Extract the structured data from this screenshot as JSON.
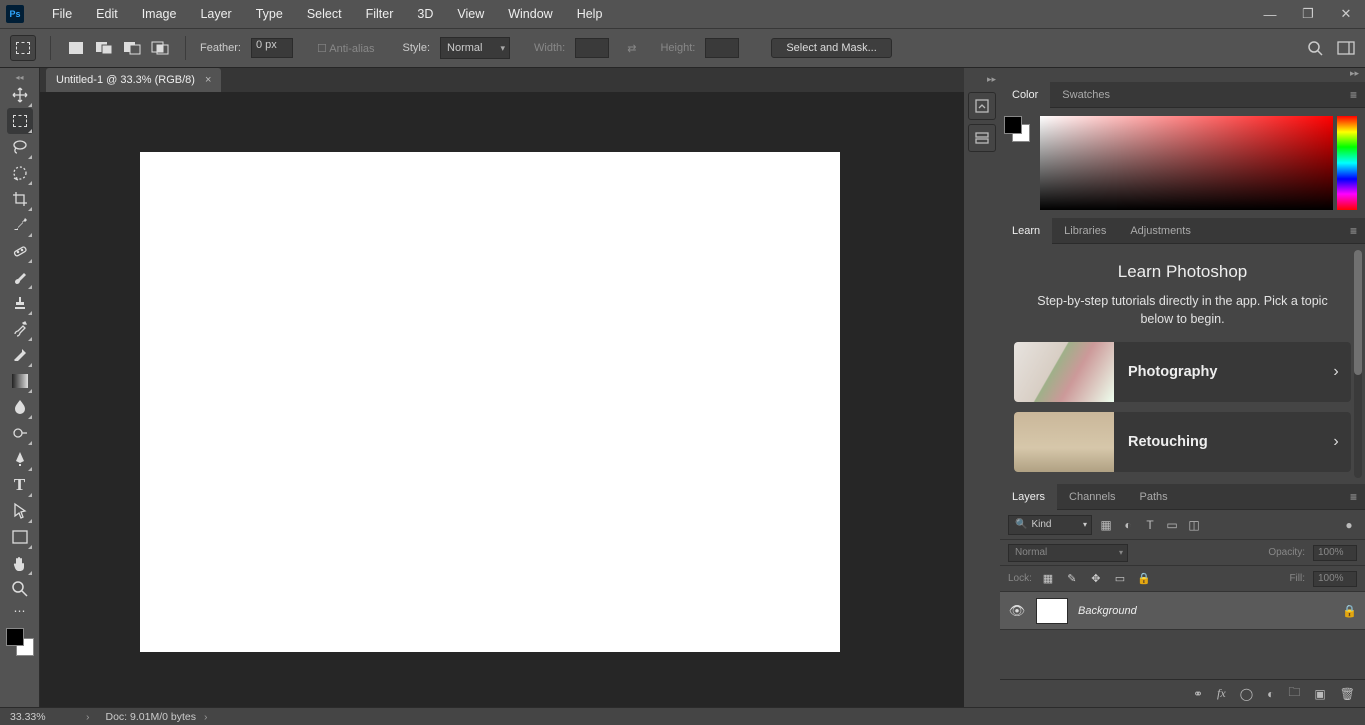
{
  "menu": [
    "File",
    "Edit",
    "Image",
    "Layer",
    "Type",
    "Select",
    "Filter",
    "3D",
    "View",
    "Window",
    "Help"
  ],
  "options": {
    "feather_label": "Feather:",
    "feather_value": "0 px",
    "antialias_label": "Anti-alias",
    "style_label": "Style:",
    "style_value": "Normal",
    "width_label": "Width:",
    "height_label": "Height:",
    "select_mask": "Select and Mask..."
  },
  "tab_title": "Untitled-1 @ 33.3% (RGB/8)",
  "color_tabs": [
    "Color",
    "Swatches"
  ],
  "learn_tabs": [
    "Learn",
    "Libraries",
    "Adjustments"
  ],
  "learn": {
    "title": "Learn Photoshop",
    "subtitle": "Step-by-step tutorials directly in the app. Pick a topic below to begin.",
    "cards": [
      "Photography",
      "Retouching"
    ]
  },
  "layers_tabs": [
    "Layers",
    "Channels",
    "Paths"
  ],
  "layers": {
    "kind": "Kind",
    "blend": "Normal",
    "opacity_label": "Opacity:",
    "opacity_value": "100%",
    "lock_label": "Lock:",
    "fill_label": "Fill:",
    "fill_value": "100%",
    "layer_name": "Background"
  },
  "status": {
    "zoom": "33.33%",
    "doc": "Doc: 9.01M/0 bytes"
  }
}
